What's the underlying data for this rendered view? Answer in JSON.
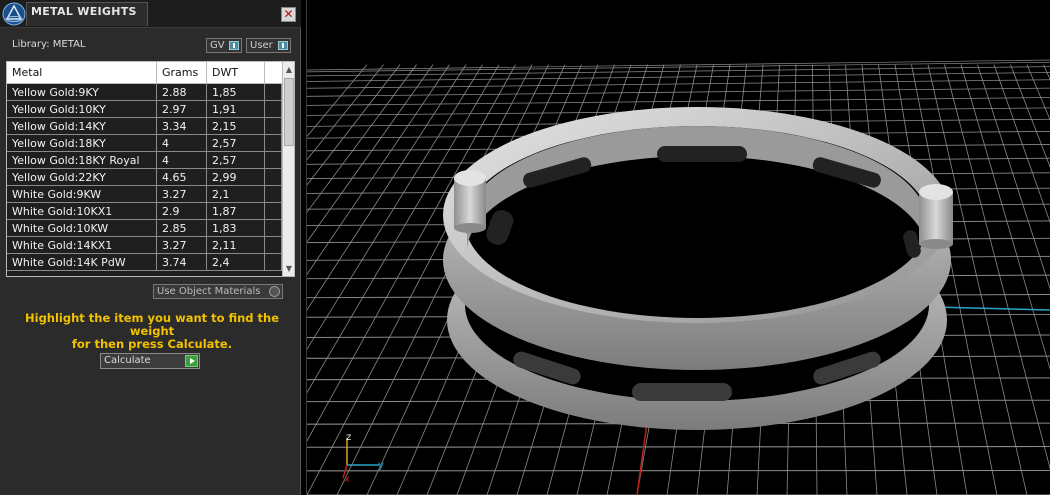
{
  "panel": {
    "title": "METAL WEIGHTS",
    "close_label": "✕",
    "library_label": "Library: METAL",
    "gv_label": "GV",
    "user_label": "User",
    "columns": {
      "metal": "Metal",
      "grams": "Grams",
      "dwt": "DWT"
    },
    "rows": [
      {
        "metal": "Yellow Gold:9KY",
        "grams": "2.88",
        "dwt": "1,85"
      },
      {
        "metal": "Yellow Gold:10KY",
        "grams": "2.97",
        "dwt": "1,91"
      },
      {
        "metal": "Yellow Gold:14KY",
        "grams": "3.34",
        "dwt": "2,15"
      },
      {
        "metal": "Yellow Gold:18KY",
        "grams": "4",
        "dwt": "2,57"
      },
      {
        "metal": "Yellow Gold:18KY Royal",
        "grams": "4",
        "dwt": "2,57"
      },
      {
        "metal": "Yellow Gold:22KY",
        "grams": "4.65",
        "dwt": "2,99"
      },
      {
        "metal": "White Gold:9KW",
        "grams": "3.27",
        "dwt": "2,1"
      },
      {
        "metal": "White Gold:10KX1",
        "grams": "2.9",
        "dwt": "1,87"
      },
      {
        "metal": "White Gold:10KW",
        "grams": "2.85",
        "dwt": "1,83"
      },
      {
        "metal": "White Gold:14KX1",
        "grams": "3.27",
        "dwt": "2,11"
      },
      {
        "metal": "White Gold:14K PdW",
        "grams": "3.74",
        "dwt": "2,4"
      }
    ],
    "use_object_materials_label": "Use Object Materials",
    "instruction_line1": "Highlight the item you want to find the weight",
    "instruction_line2": "for then press Calculate.",
    "calculate_label": "Calculate"
  },
  "viewport": {
    "axis_labels": {
      "x": "x",
      "y": "y",
      "z": "z"
    },
    "colors": {
      "grid": "#8a8a8a",
      "x_axis": "#c0201a",
      "y_axis": "#2aa6c8",
      "ring": "#bdbdbd"
    }
  }
}
